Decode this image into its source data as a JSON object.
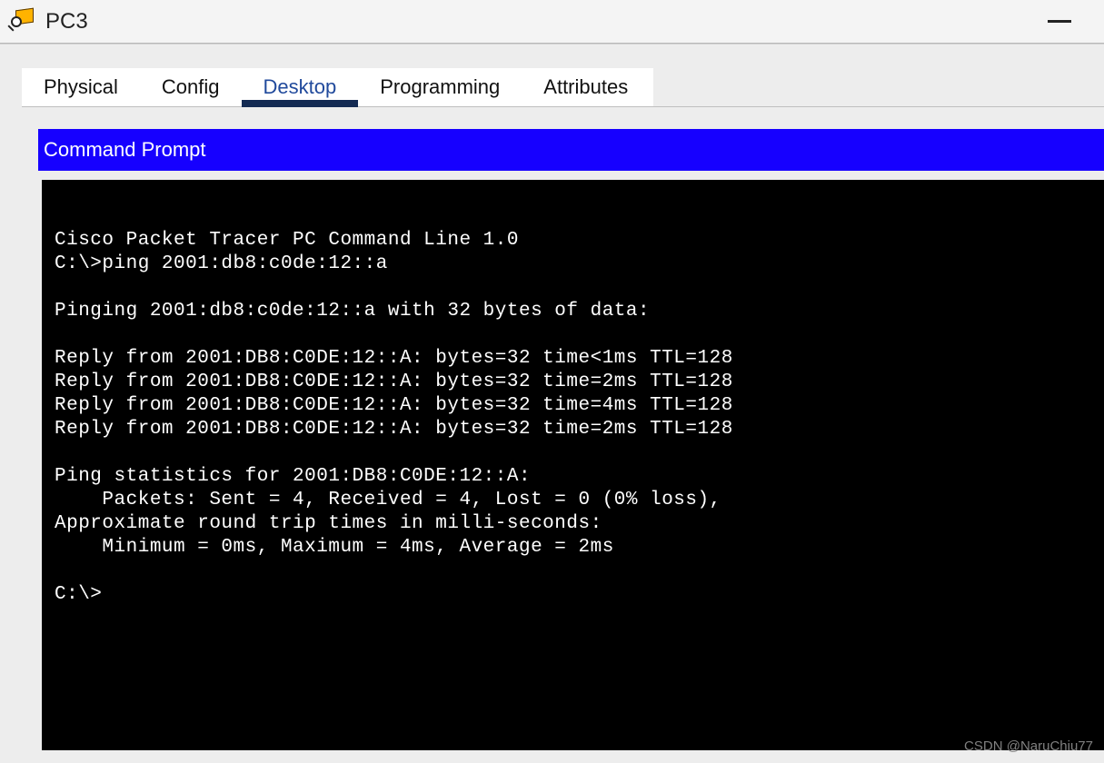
{
  "window": {
    "title": "PC3"
  },
  "tabs": {
    "items": [
      "Physical",
      "Config",
      "Desktop",
      "Programming",
      "Attributes"
    ],
    "active_index": 2
  },
  "panel": {
    "title": "Command Prompt"
  },
  "terminal": {
    "lines": [
      "",
      "Cisco Packet Tracer PC Command Line 1.0",
      "C:\\>ping 2001:db8:c0de:12::a",
      "",
      "Pinging 2001:db8:c0de:12::a with 32 bytes of data:",
      "",
      "Reply from 2001:DB8:C0DE:12::A: bytes=32 time<1ms TTL=128",
      "Reply from 2001:DB8:C0DE:12::A: bytes=32 time=2ms TTL=128",
      "Reply from 2001:DB8:C0DE:12::A: bytes=32 time=4ms TTL=128",
      "Reply from 2001:DB8:C0DE:12::A: bytes=32 time=2ms TTL=128",
      "",
      "Ping statistics for 2001:DB8:C0DE:12::A:",
      "    Packets: Sent = 4, Received = 4, Lost = 0 (0% loss),",
      "Approximate round trip times in milli-seconds:",
      "    Minimum = 0ms, Maximum = 4ms, Average = 2ms",
      "",
      "C:\\>"
    ]
  },
  "watermark": "CSDN @NaruChiu77"
}
